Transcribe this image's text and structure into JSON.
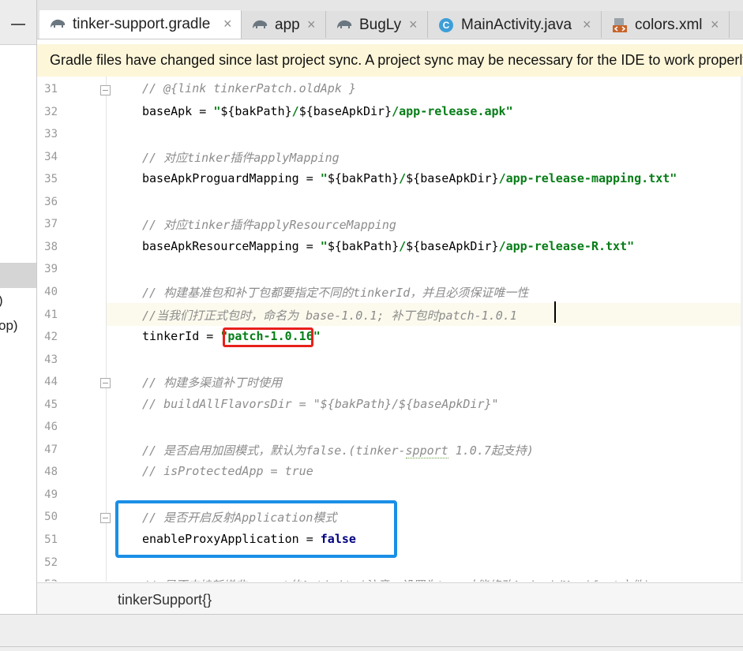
{
  "tabs": [
    {
      "label": "tinker-support.gradle",
      "icon": "gradle-elephant-icon",
      "active": true
    },
    {
      "label": "app",
      "icon": "gradle-elephant-icon",
      "active": false
    },
    {
      "label": "BugLy",
      "icon": "gradle-elephant-icon",
      "active": false
    },
    {
      "label": "MainActivity.java",
      "icon": "java-class-icon",
      "icon_glyph": "C",
      "active": false
    },
    {
      "label": "colors.xml",
      "icon": "xml-file-icon",
      "active": false
    }
  ],
  "tab_close_glyph": "×",
  "notification": {
    "text": "Gradle files have changed since last project sync. A project sync may be necessary for the IDE to work properly."
  },
  "left_panel": {
    "fragments": [
      ")",
      "op)"
    ]
  },
  "editor": {
    "current_line": 41,
    "lines": [
      {
        "n": "31",
        "parts": [
          {
            "t": "// @{link tinkerPatch.oldApk }",
            "c": "cm"
          }
        ]
      },
      {
        "n": "32",
        "parts": [
          {
            "t": "baseApk = ",
            "c": "plain"
          },
          {
            "t": "\"",
            "c": "str"
          },
          {
            "t": "${bakPath}",
            "c": "plain"
          },
          {
            "t": "/",
            "c": "str"
          },
          {
            "t": "${baseApkDir}",
            "c": "plain"
          },
          {
            "t": "/app-release.apk\"",
            "c": "str"
          }
        ]
      },
      {
        "n": "33",
        "parts": []
      },
      {
        "n": "34",
        "parts": [
          {
            "t": "// 对应tinker插件applyMapping",
            "c": "cm"
          }
        ]
      },
      {
        "n": "35",
        "parts": [
          {
            "t": "baseApkProguardMapping = ",
            "c": "plain"
          },
          {
            "t": "\"",
            "c": "str"
          },
          {
            "t": "${bakPath}",
            "c": "plain"
          },
          {
            "t": "/",
            "c": "str"
          },
          {
            "t": "${baseApkDir}",
            "c": "plain"
          },
          {
            "t": "/app-release-mapping.txt\"",
            "c": "str"
          }
        ]
      },
      {
        "n": "36",
        "parts": []
      },
      {
        "n": "37",
        "parts": [
          {
            "t": "// 对应tinker插件applyResourceMapping",
            "c": "cm"
          }
        ]
      },
      {
        "n": "38",
        "parts": [
          {
            "t": "baseApkResourceMapping = ",
            "c": "plain"
          },
          {
            "t": "\"",
            "c": "str"
          },
          {
            "t": "${bakPath}",
            "c": "plain"
          },
          {
            "t": "/",
            "c": "str"
          },
          {
            "t": "${baseApkDir}",
            "c": "plain"
          },
          {
            "t": "/app-release-R.txt\"",
            "c": "str"
          }
        ]
      },
      {
        "n": "39",
        "parts": []
      },
      {
        "n": "40",
        "parts": [
          {
            "t": "// 构建基准包和补丁包都要指定不同的tinkerId，并且必须保证唯一性",
            "c": "cm"
          }
        ]
      },
      {
        "n": "41",
        "parts": [
          {
            "t": "//当我们打正式包时，命名为 base-1.0.1; 补丁包时patch-1.0.1",
            "c": "cm"
          }
        ]
      },
      {
        "n": "42",
        "parts": [
          {
            "t": "tinkerId = ",
            "c": "plain"
          },
          {
            "t": "\"patch-1.0.16\"",
            "c": "str"
          }
        ]
      },
      {
        "n": "43",
        "parts": []
      },
      {
        "n": "44",
        "parts": [
          {
            "t": "// 构建多渠道补丁时使用",
            "c": "cm"
          }
        ]
      },
      {
        "n": "45",
        "parts": [
          {
            "t": "// buildAllFlavorsDir = \"${bakPath}/${baseApkDir}\"",
            "c": "cm"
          }
        ]
      },
      {
        "n": "46",
        "parts": []
      },
      {
        "n": "47",
        "parts": [
          {
            "t": "// 是否启用加固模式，默认为false.(tinker-",
            "c": "cm"
          },
          {
            "t": "spport",
            "c": "cm squig"
          },
          {
            "t": " 1.0.7起支持)",
            "c": "cm"
          }
        ]
      },
      {
        "n": "48",
        "parts": [
          {
            "t": "// isProtectedApp = true",
            "c": "cm"
          }
        ]
      },
      {
        "n": "49",
        "parts": []
      },
      {
        "n": "50",
        "parts": [
          {
            "t": "// 是否开启反射Application模式",
            "c": "cm"
          }
        ]
      },
      {
        "n": "51",
        "parts": [
          {
            "t": "enableProxyApplication = ",
            "c": "plain"
          },
          {
            "t": "false",
            "c": "kw"
          }
        ]
      },
      {
        "n": "52",
        "parts": []
      },
      {
        "n": "53",
        "parts": [
          {
            "t": "// 是否支持新增非export的Activity(注意：设置为true才能修改AndroidManifest文件)",
            "c": "cm"
          }
        ]
      }
    ]
  },
  "breadcrumb": {
    "text": "tinkerSupport{}"
  },
  "colors": {
    "highlight_red": "#e8201b",
    "highlight_blue": "#1a8fe6",
    "string_green": "#067d17",
    "comment_gray": "#8c8c8c",
    "notification_bg": "#fdf6d9"
  }
}
